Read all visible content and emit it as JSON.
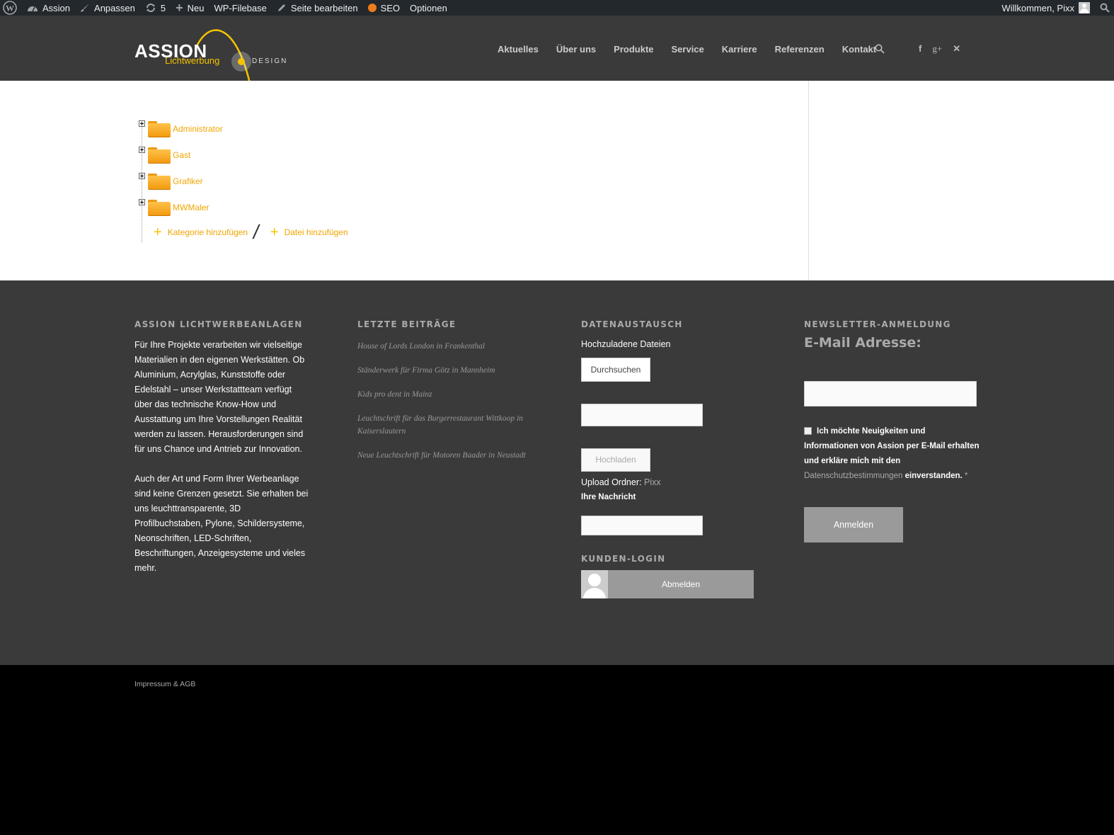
{
  "adminbar": {
    "site_name": "Assion",
    "customize": "Anpassen",
    "updates": "5",
    "new": "Neu",
    "filebase": "WP-Filebase",
    "edit_page": "Seite bearbeiten",
    "seo": "SEO",
    "options": "Optionen",
    "welcome": "Willkommen, Pixx"
  },
  "header": {
    "logo_main": "ASSION",
    "logo_sub": "Lichtwerbung",
    "logo_design": "DESIGN",
    "nav": [
      "Aktuelles",
      "Über uns",
      "Produkte",
      "Service",
      "Karriere",
      "Referenzen",
      "Kontakt"
    ],
    "accent": "#f5c400"
  },
  "filetree": {
    "folders": [
      "Administrator",
      "Gast",
      "Grafiker",
      "MWMaler"
    ],
    "add_category": "Kategorie hinzufügen",
    "add_file": "Datei hinzufügen"
  },
  "footer": {
    "about": {
      "title": "ASSION LICHTWERBEANLAGEN",
      "p1": "Für Ihre Projekte verarbeiten wir vielseitige Materialien in den eigenen Werkstätten. Ob Aluminium, Acrylglas, Kunststoffe oder Edelstahl – unser Werkstattteam verfügt über das technische Know-How und Ausstattung um Ihre Vorstellungen Realität werden zu lassen. Herausforderungen sind für uns Chance und Antrieb zur Innovation.",
      "p2": "Auch der Art und Form Ihrer Werbeanlage sind keine Grenzen gesetzt. Sie erhalten bei uns leuchttransparente, 3D Profilbuchstaben, Pylone, Schildersysteme, Neonschriften, LED-Schriften, Beschriftungen, Anzeigesysteme und vieles mehr."
    },
    "posts": {
      "title": "LETZTE BEITRÄGE",
      "items": [
        "House of Lords London in Frankenthal",
        "Ständerwerk für Firma Götz in Mannheim",
        "Kids pro dent in Mainz",
        "Leuchtschrift für das Burgerrestaurant Wittkoop in Kaiserslautern",
        "Neue Leuchtschrift für Motoren Baader in Neustadt"
      ]
    },
    "data": {
      "title": "DATENAUSTAUSCH",
      "files_label": "Hochzuladene Dateien",
      "browse": "Durchsuchen",
      "upload": "Hochladen",
      "folder_label": "Upload Ordner:",
      "folder_value": "Pixx",
      "message_label": "Ihre Nachricht",
      "login_title": "KUNDEN-LOGIN",
      "logout": "Abmelden"
    },
    "newsletter": {
      "title": "NEWSLETTER-ANMELDUNG",
      "email_label": "E-Mail Adresse:",
      "consent_1": "Ich möchte Neuigkeiten und Informationen von Assion per E-Mail erhalten und erkläre mich mit den",
      "privacy_link": "Datenschutzbestimmungen",
      "consent_2": "einverstanden.",
      "required_mark": "*",
      "submit": "Anmelden"
    }
  },
  "socket": {
    "impressum": "Impressum & AGB"
  }
}
